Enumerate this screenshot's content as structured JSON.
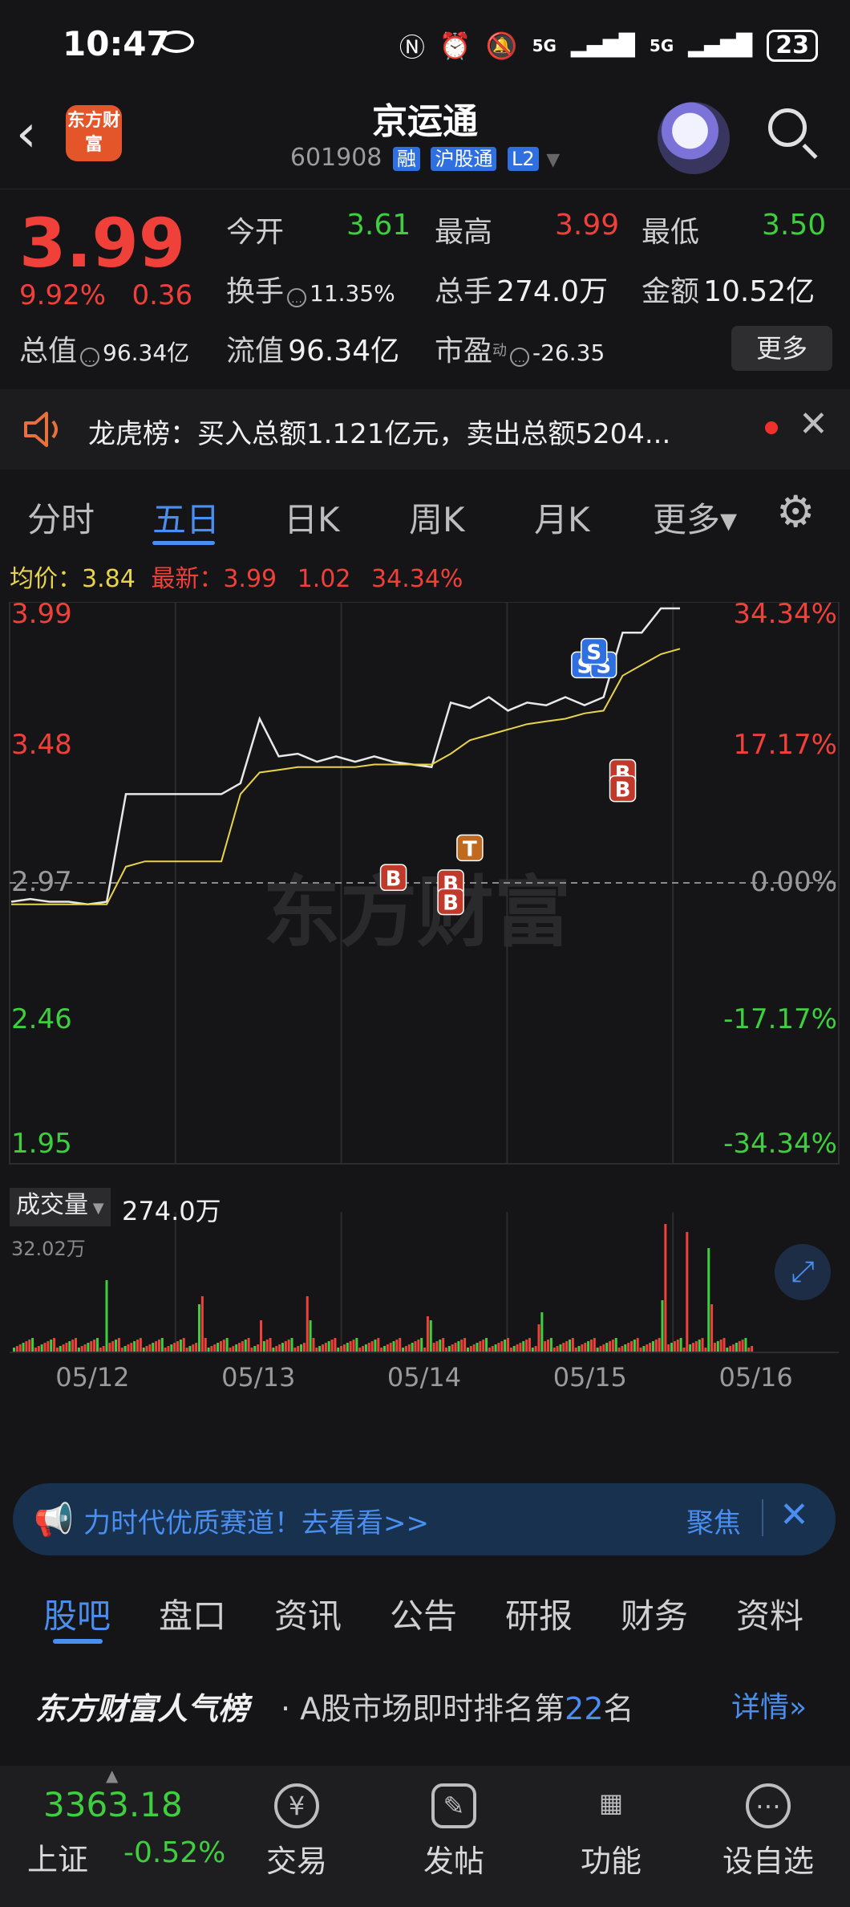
{
  "status_bar": {
    "time": "10:47",
    "network1": "5G",
    "network2": "5G",
    "battery": "23"
  },
  "header": {
    "logo_text": "东方财富",
    "title": "京运通",
    "code": "601908",
    "tags": [
      "融",
      "沪股通",
      "L2"
    ]
  },
  "quote": {
    "price": "3.99",
    "change_pct": "9.92%",
    "change": "0.36",
    "open_label": "今开",
    "open": "3.61",
    "high_label": "最高",
    "high": "3.99",
    "low_label": "最低",
    "low": "3.50",
    "turnover_label": "换手",
    "turnover": "11.35%",
    "volume_label": "总手",
    "volume": "274.0万",
    "amount_label": "金额",
    "amount": "10.52亿",
    "mktcap_label": "总值",
    "mktcap": "96.34亿",
    "float_label": "流值",
    "float": "96.34亿",
    "pe_label": "市盈",
    "pe_sup": "动",
    "pe": "-26.35",
    "more_label": "更多"
  },
  "notice": {
    "text": "龙虎榜：买入总额1.121亿元，卖出总额5204..."
  },
  "chart_tabs": [
    "分时",
    "五日",
    "日K",
    "周K",
    "月K",
    "更多▾"
  ],
  "chart_info": {
    "avg_label": "均价：",
    "avg": "3.84",
    "latest_label": "最新：",
    "latest": "3.99",
    "latest_chg": "1.02",
    "latest_pct": "34.34%"
  },
  "chart_data": {
    "type": "line",
    "y_left_ticks": [
      "3.99",
      "3.48",
      "2.97",
      "2.46",
      "1.95"
    ],
    "y_right_ticks": [
      "34.34%",
      "17.17%",
      "0.00%",
      "-17.17%",
      "-34.34%"
    ],
    "ylim": [
      1.95,
      3.99
    ],
    "baseline": 2.97,
    "x_labels": [
      "05/12",
      "05/13",
      "05/14",
      "05/15",
      "05/16"
    ],
    "series": [
      {
        "color": "#e8e8e8",
        "values": [
          2.9,
          2.91,
          2.9,
          2.9,
          2.89,
          2.9,
          3.3,
          3.3,
          3.3,
          3.3,
          3.3,
          3.3,
          3.34,
          3.58,
          3.44,
          3.45,
          3.42,
          3.44,
          3.42,
          3.44,
          3.42,
          3.41,
          3.4,
          3.64,
          3.62,
          3.66,
          3.61,
          3.64,
          3.63,
          3.66,
          3.63,
          3.66,
          3.9,
          3.9,
          3.99,
          3.99
        ]
      },
      {
        "color": "#e8d44a",
        "values": [
          2.89,
          2.89,
          2.89,
          2.89,
          2.89,
          2.89,
          3.03,
          3.05,
          3.05,
          3.05,
          3.05,
          3.05,
          3.3,
          3.38,
          3.39,
          3.4,
          3.4,
          3.4,
          3.4,
          3.41,
          3.41,
          3.41,
          3.41,
          3.45,
          3.5,
          3.52,
          3.54,
          3.56,
          3.57,
          3.58,
          3.6,
          3.61,
          3.74,
          3.78,
          3.82,
          3.84
        ]
      }
    ]
  },
  "volume": {
    "label": "成交量",
    "value": "274.0万",
    "max_label": "32.02万"
  },
  "watermark": "东方财富",
  "ad": {
    "text": "力时代优质赛道！去看看>>",
    "right": "聚焦"
  },
  "bottom_tabs": [
    "股吧",
    "盘口",
    "资讯",
    "公告",
    "研报",
    "财务",
    "资料"
  ],
  "rank": {
    "title": "东方财富人气榜",
    "text": "· A股市场即时排名第",
    "rank": "22",
    "suffix": "名",
    "detail": "详情"
  },
  "index": {
    "value": "3363.18",
    "name": "上证",
    "change": "-0.52%"
  },
  "bottom_nav": [
    {
      "label": "交易",
      "icon": "trade-icon"
    },
    {
      "label": "发帖",
      "icon": "post-icon"
    },
    {
      "label": "功能",
      "icon": "grid-icon"
    },
    {
      "label": "设自选",
      "icon": "more-icon"
    }
  ]
}
